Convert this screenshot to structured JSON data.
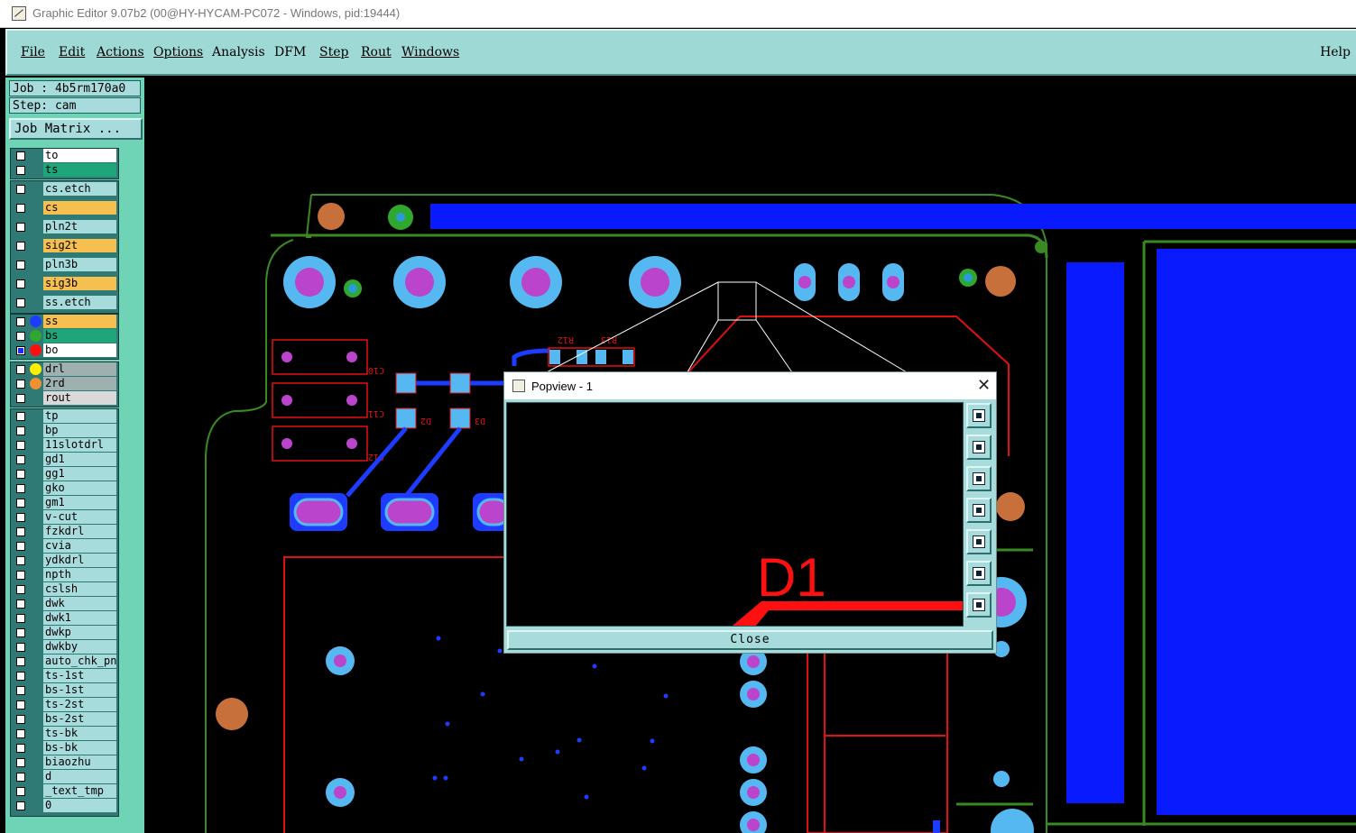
{
  "window": {
    "title": "Graphic Editor 9.07b2 (00@HY-HYCAM-PC072 - Windows, pid:19444)"
  },
  "menu": {
    "file": "File",
    "edit": "Edit",
    "actions": "Actions",
    "options": "Options",
    "analysis": "Analysis",
    "dfm": "DFM",
    "step": "Step",
    "rout": "Rout",
    "windows": "Windows",
    "help": "Help"
  },
  "job": {
    "job_line": "Job : 4b5rm170a0",
    "step_line": "Step: cam",
    "matrix_button": "Job Matrix ..."
  },
  "layers": {
    "group1": [
      "to",
      "ts"
    ],
    "group2": [
      "cs.etch",
      "cs",
      "pln2t",
      "sig2t",
      "pln3b",
      "sig3b",
      "ss.etch"
    ],
    "group3": [
      "ss",
      "bs",
      "bo"
    ],
    "group4": [
      "drl",
      "2rd",
      "rout"
    ],
    "group5": [
      "tp",
      "bp",
      "11slotdrl",
      "gd1",
      "gg1",
      "gko",
      "gm1",
      "v-cut",
      "fzkdrl",
      "cvia",
      "ydkdrl",
      "npth",
      "cslsh",
      "dwk",
      "dwk1",
      "dwkp",
      "dwkby",
      "auto_chk_pn",
      "ts-1st",
      "bs-1st",
      "ts-2st",
      "bs-2st",
      "ts-bk",
      "bs-bk",
      "biaozhu",
      "d",
      "_text_tmp",
      "0"
    ]
  },
  "layer_colors": {
    "white": "#ffffff",
    "green": "#1fa57a",
    "cyan": "#a8dcdc",
    "orange": "#f5c04f",
    "grey": "#9fb0b0",
    "light": "#d9d9d9",
    "blue_dot": "#1e3cff",
    "green_dot": "#2ea82e",
    "red_dot": "#ff1010",
    "yellow_dot": "#ffee00",
    "orange_dot": "#f09030"
  },
  "board_labels": {
    "c10": "C10",
    "c11": "C11",
    "c12": "C12",
    "d2": "D2",
    "d3": "D3",
    "r12": "R12",
    "r13": "R13",
    "d1": "D1"
  },
  "popview": {
    "title": "Popview - 1",
    "close_label": "Close",
    "zoom_label": "D1"
  },
  "popview_tools": [
    "zoom-home-icon",
    "pan-up-icon",
    "pan-down-icon",
    "pan-left-icon",
    "pan-right-icon",
    "zoom-in-icon",
    "zoom-out-icon"
  ]
}
